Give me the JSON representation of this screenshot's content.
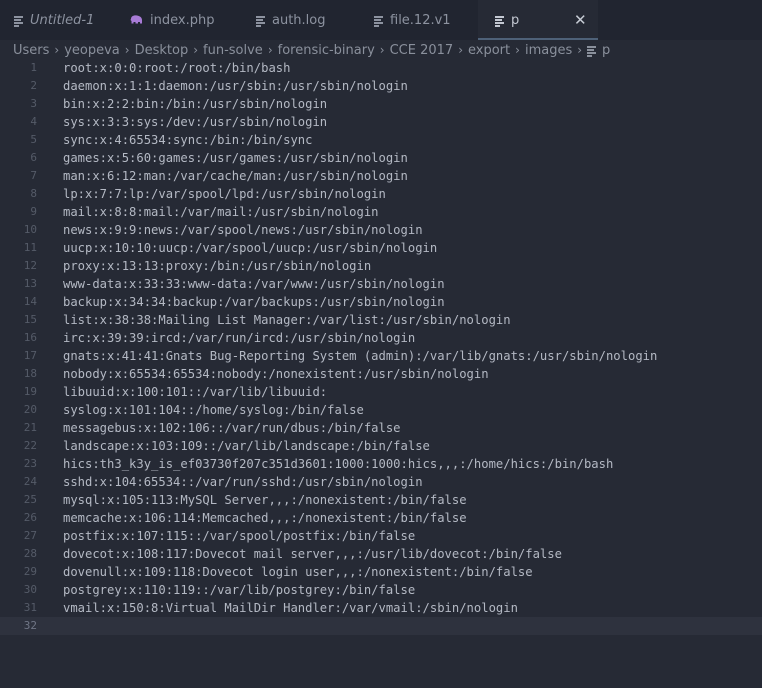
{
  "tabs": [
    {
      "label": "Untitled-1",
      "icon": "lines-icon",
      "style": "untitled"
    },
    {
      "label": "index.php",
      "icon": "php-elephant-icon",
      "style": "normal"
    },
    {
      "label": "auth.log",
      "icon": "lines-icon",
      "style": "normal"
    },
    {
      "label": "file.12.v1",
      "icon": "lines-icon",
      "style": "normal"
    },
    {
      "label": "p",
      "icon": "lines-icon",
      "style": "active",
      "close_glyph": "✕"
    }
  ],
  "breadcrumb": {
    "segments": [
      "Users",
      "yeopeva",
      "Desktop",
      "fun-solve",
      "forensic-binary",
      "CCE 2017",
      "export",
      "images"
    ],
    "separator": "›",
    "file": "p"
  },
  "editor": {
    "current_line": 32,
    "lines": [
      "root:x:0:0:root:/root:/bin/bash",
      "daemon:x:1:1:daemon:/usr/sbin:/usr/sbin/nologin",
      "bin:x:2:2:bin:/bin:/usr/sbin/nologin",
      "sys:x:3:3:sys:/dev:/usr/sbin/nologin",
      "sync:x:4:65534:sync:/bin:/bin/sync",
      "games:x:5:60:games:/usr/games:/usr/sbin/nologin",
      "man:x:6:12:man:/var/cache/man:/usr/sbin/nologin",
      "lp:x:7:7:lp:/var/spool/lpd:/usr/sbin/nologin",
      "mail:x:8:8:mail:/var/mail:/usr/sbin/nologin",
      "news:x:9:9:news:/var/spool/news:/usr/sbin/nologin",
      "uucp:x:10:10:uucp:/var/spool/uucp:/usr/sbin/nologin",
      "proxy:x:13:13:proxy:/bin:/usr/sbin/nologin",
      "www-data:x:33:33:www-data:/var/www:/usr/sbin/nologin",
      "backup:x:34:34:backup:/var/backups:/usr/sbin/nologin",
      "list:x:38:38:Mailing List Manager:/var/list:/usr/sbin/nologin",
      "irc:x:39:39:ircd:/var/run/ircd:/usr/sbin/nologin",
      "gnats:x:41:41:Gnats Bug-Reporting System (admin):/var/lib/gnats:/usr/sbin/nologin",
      "nobody:x:65534:65534:nobody:/nonexistent:/usr/sbin/nologin",
      "libuuid:x:100:101::/var/lib/libuuid:",
      "syslog:x:101:104::/home/syslog:/bin/false",
      "messagebus:x:102:106::/var/run/dbus:/bin/false",
      "landscape:x:103:109::/var/lib/landscape:/bin/false",
      "hics:th3_k3y_is_ef03730f207c351d3601:1000:1000:hics,,,:/home/hics:/bin/bash",
      "sshd:x:104:65534::/var/run/sshd:/usr/sbin/nologin",
      "mysql:x:105:113:MySQL Server,,,:/nonexistent:/bin/false",
      "memcache:x:106:114:Memcached,,,:/nonexistent:/bin/false",
      "postfix:x:107:115::/var/spool/postfix:/bin/false",
      "dovecot:x:108:117:Dovecot mail server,,,:/usr/lib/dovecot:/bin/false",
      "dovenull:x:109:118:Dovecot login user,,,:/nonexistent:/bin/false",
      "postgrey:x:110:119::/var/lib/postgrey:/bin/false",
      "vmail:x:150:8:Virtual MailDir Handler:/var/vmail:/sbin/nologin",
      ""
    ]
  },
  "colors": {
    "editor_bg": "#262a35",
    "tabbar_bg": "#212530",
    "current_line_bg": "#2e323e",
    "text": "#b4b9c4",
    "line_number": "#555b68",
    "php_icon": "#a87bd6"
  }
}
